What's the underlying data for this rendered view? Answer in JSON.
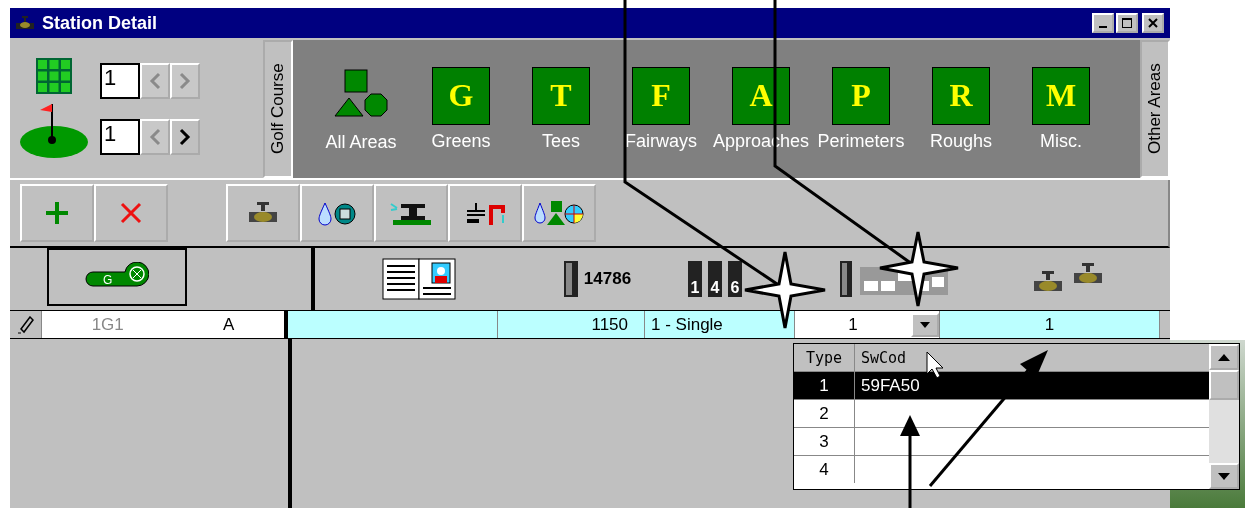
{
  "window": {
    "title": "Station Detail"
  },
  "spinners": [
    {
      "value": "1",
      "prev_disabled": true,
      "next_disabled": true
    },
    {
      "value": "1",
      "prev_disabled": true,
      "next_disabled": false
    }
  ],
  "golf_course_tab": "Golf Course",
  "areas": [
    {
      "kind": "shapes",
      "label": "All Areas"
    },
    {
      "kind": "letter",
      "letter": "G",
      "label": "Greens"
    },
    {
      "kind": "letter",
      "letter": "T",
      "label": "Tees"
    },
    {
      "kind": "letter",
      "letter": "F",
      "label": "Fairways"
    },
    {
      "kind": "letter",
      "letter": "A",
      "label": "Approaches"
    },
    {
      "kind": "letter",
      "letter": "P",
      "label": "Perimeters"
    },
    {
      "kind": "letter",
      "letter": "R",
      "label": "Roughs"
    },
    {
      "kind": "letter",
      "letter": "M",
      "label": "Misc."
    }
  ],
  "other_areas_tab": "Other Areas",
  "header": {
    "tag_letter": "G",
    "count": "14786",
    "digits": [
      "1",
      "4",
      "6"
    ]
  },
  "row": {
    "station": "1G1",
    "area": "A",
    "flow": "1150",
    "mode": "1 - Single",
    "type_value": "1",
    "valves": "1"
  },
  "dropdown": {
    "columns": [
      "Type",
      "SwCod"
    ],
    "rows": [
      {
        "type": "1",
        "code": "59FA50",
        "selected": true
      },
      {
        "type": "2",
        "selected": false
      },
      {
        "type": "3",
        "selected": false
      },
      {
        "type": "4",
        "selected": false
      }
    ]
  }
}
